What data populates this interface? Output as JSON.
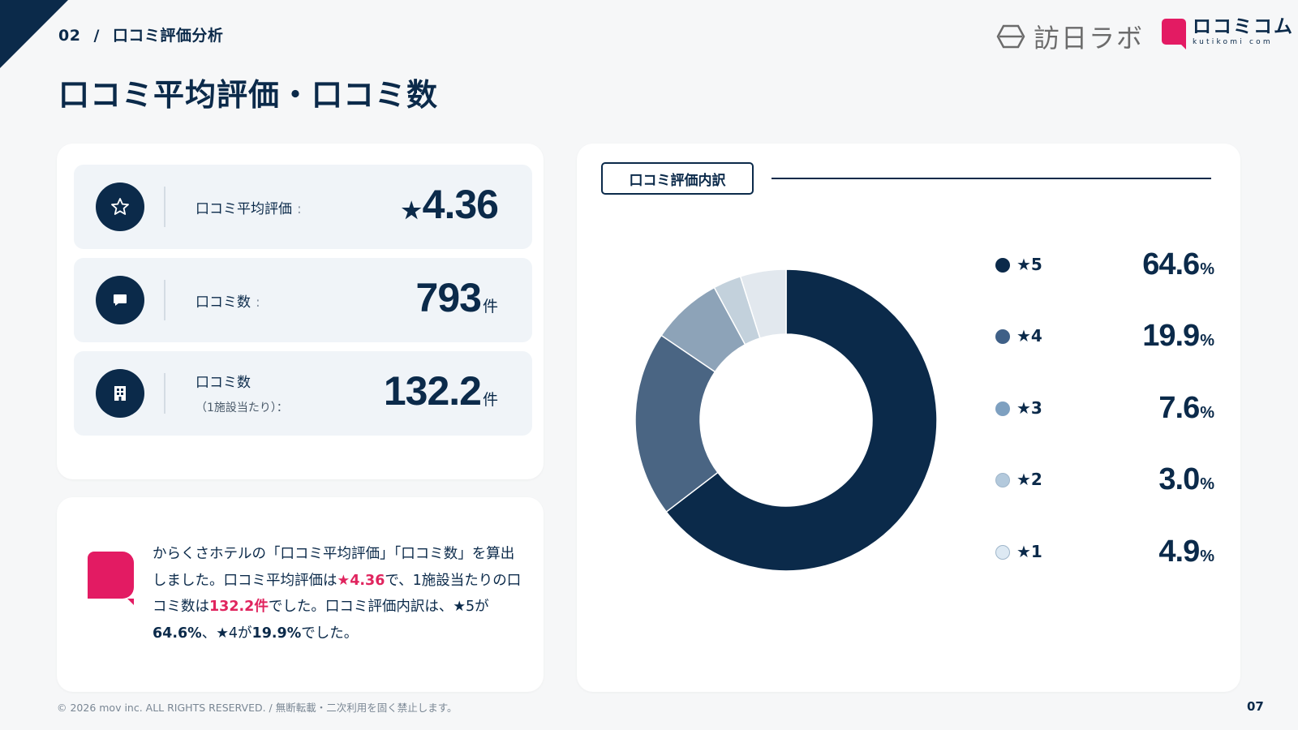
{
  "header": {
    "section_number": "02",
    "section_separator": "/",
    "section_title": "口コミ評価分析",
    "page_title": "口コミ平均評価・口コミ数"
  },
  "brand": {
    "lab_name": "訪日ラボ",
    "kutikomi_name": "ロコミコム",
    "kutikomi_sub": "kutikomi com"
  },
  "metrics": [
    {
      "icon": "star-outline-icon",
      "label": "口コミ平均評価",
      "colon": ":",
      "sublabel": "",
      "prefix": "★",
      "value": "4.36",
      "unit": ""
    },
    {
      "icon": "speech-bubble-icon",
      "label": "口コミ数",
      "colon": ":",
      "sublabel": "",
      "prefix": "",
      "value": "793",
      "unit": "件"
    },
    {
      "icon": "building-icon",
      "label": "口コミ数",
      "colon": "",
      "sublabel": "（1施設当たり）：",
      "prefix": "",
      "value": "132.2",
      "unit": "件"
    }
  ],
  "note": {
    "t1": "からくさホテルの「口コミ平均評価」「口コミ数」を算出しました。口コミ平均評価は",
    "h1": "★4.36",
    "t2": "で、1施設当たりの口コミ数は",
    "h2": "132.2件",
    "t3": "でした。口コミ評価内訳は、★5が",
    "b1": "64.6%",
    "t4": "、★4が",
    "b2": "19.9%",
    "t5": "でした。"
  },
  "chart_data": {
    "type": "pie",
    "title": "口コミ評価内訳",
    "donut": true,
    "categories": [
      "★5",
      "★4",
      "★3",
      "★2",
      "★1"
    ],
    "values": [
      64.6,
      19.9,
      7.6,
      3.0,
      4.9
    ],
    "value_labels": [
      "64.6",
      "19.9",
      "7.6",
      "3.0",
      "4.9"
    ],
    "unit": "%",
    "colors": [
      "#0b2a4a",
      "#4a6583",
      "#8da3b8",
      "#c3d1dc",
      "#e2e8ee"
    ],
    "legend_colors": [
      "#0b2a4a",
      "#3f6087",
      "#7ea0c0",
      "#b3c9dc",
      "#dde9f3"
    ],
    "legend_position": "right"
  },
  "footer": {
    "copyright": "© 2026 mov inc. ALL RIGHTS RESERVED. / 無断転載・二次利用を固く禁止します。",
    "page_number": "07"
  }
}
